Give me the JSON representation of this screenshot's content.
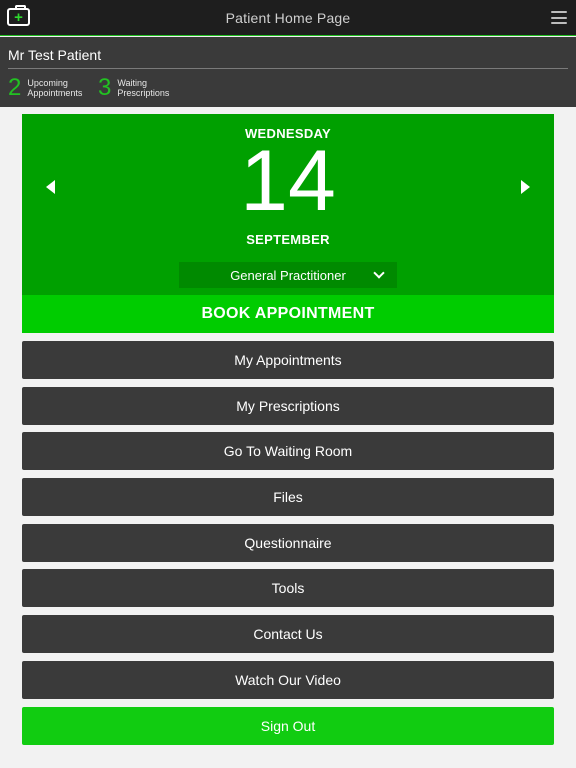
{
  "header": {
    "title": "Patient Home Page",
    "app_icon": "medical-case-icon",
    "menu_icon": "hamburger-menu-icon"
  },
  "patient": {
    "name": "Mr Test Patient",
    "upcoming": {
      "count": "2",
      "label_line1": "Upcoming",
      "label_line2": "Appointments"
    },
    "waiting": {
      "count": "3",
      "label_line1": "Waiting",
      "label_line2": "Prescriptions"
    }
  },
  "date_card": {
    "weekday": "WEDNESDAY",
    "day": "14",
    "month": "SEPTEMBER",
    "practitioner": "General Practitioner",
    "book_label": "BOOK APPOINTMENT"
  },
  "menu": {
    "items": [
      "My Appointments",
      "My Prescriptions",
      "Go To Waiting Room",
      "Files",
      "Questionnaire",
      "Tools",
      "Contact Us",
      "Watch Our Video"
    ],
    "sign_out": "Sign Out"
  },
  "colors": {
    "header_bg": "#1e1e1e",
    "panel_bg": "#3a3a3a",
    "date_card_bg": "#00a000",
    "book_button_bg": "#00cc00",
    "sign_out_bg": "#11cc11",
    "accent_count": "#22c222"
  }
}
